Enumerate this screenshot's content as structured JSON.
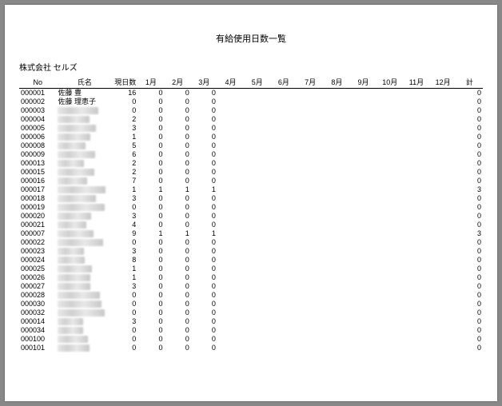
{
  "title": "有給使用日数一覧",
  "company": "株式会社 セルズ",
  "headers": {
    "no": "No",
    "name": "氏名",
    "current": "現日数",
    "months": [
      "1月",
      "2月",
      "3月",
      "4月",
      "5月",
      "6月",
      "7月",
      "8月",
      "9月",
      "10月",
      "11月",
      "12月"
    ],
    "total": "計"
  },
  "rows": [
    {
      "no": "000001",
      "name": "佐藤 豊",
      "redact": false,
      "cur": 16,
      "m": [
        0,
        0,
        0,
        "",
        "",
        "",
        "",
        "",
        "",
        "",
        "",
        ""
      ],
      "tot": 0
    },
    {
      "no": "000002",
      "name": "佐藤 理恵子",
      "redact": false,
      "cur": 0,
      "m": [
        0,
        0,
        0,
        "",
        "",
        "",
        "",
        "",
        "",
        "",
        "",
        ""
      ],
      "tot": 0
    },
    {
      "no": "000003",
      "name": "",
      "redact": true,
      "cur": 0,
      "m": [
        0,
        0,
        0,
        "",
        "",
        "",
        "",
        "",
        "",
        "",
        "",
        ""
      ],
      "tot": 0
    },
    {
      "no": "000004",
      "name": "",
      "redact": true,
      "cur": 2,
      "m": [
        0,
        0,
        0,
        "",
        "",
        "",
        "",
        "",
        "",
        "",
        "",
        ""
      ],
      "tot": 0
    },
    {
      "no": "000005",
      "name": "",
      "redact": true,
      "cur": 3,
      "m": [
        0,
        0,
        0,
        "",
        "",
        "",
        "",
        "",
        "",
        "",
        "",
        ""
      ],
      "tot": 0
    },
    {
      "no": "000006",
      "name": "",
      "redact": true,
      "cur": 1,
      "m": [
        0,
        0,
        0,
        "",
        "",
        "",
        "",
        "",
        "",
        "",
        "",
        ""
      ],
      "tot": 0
    },
    {
      "no": "000008",
      "name": "",
      "redact": true,
      "cur": 5,
      "m": [
        0,
        0,
        0,
        "",
        "",
        "",
        "",
        "",
        "",
        "",
        "",
        ""
      ],
      "tot": 0
    },
    {
      "no": "000009",
      "name": "",
      "redact": true,
      "cur": 6,
      "m": [
        0,
        0,
        0,
        "",
        "",
        "",
        "",
        "",
        "",
        "",
        "",
        ""
      ],
      "tot": 0
    },
    {
      "no": "000013",
      "name": "",
      "redact": true,
      "cur": 2,
      "m": [
        0,
        0,
        0,
        "",
        "",
        "",
        "",
        "",
        "",
        "",
        "",
        ""
      ],
      "tot": 0
    },
    {
      "no": "000015",
      "name": "",
      "redact": true,
      "cur": 2,
      "m": [
        0,
        0,
        0,
        "",
        "",
        "",
        "",
        "",
        "",
        "",
        "",
        ""
      ],
      "tot": 0
    },
    {
      "no": "000016",
      "name": "",
      "redact": true,
      "cur": 7,
      "m": [
        0,
        0,
        0,
        "",
        "",
        "",
        "",
        "",
        "",
        "",
        "",
        ""
      ],
      "tot": 0
    },
    {
      "no": "000017",
      "name": "",
      "redact": true,
      "cur": 1,
      "m": [
        1,
        1,
        1,
        "",
        "",
        "",
        "",
        "",
        "",
        "",
        "",
        ""
      ],
      "tot": 3
    },
    {
      "no": "000018",
      "name": "",
      "redact": true,
      "cur": 3,
      "m": [
        0,
        0,
        0,
        "",
        "",
        "",
        "",
        "",
        "",
        "",
        "",
        ""
      ],
      "tot": 0
    },
    {
      "no": "000019",
      "name": "",
      "redact": true,
      "cur": 0,
      "m": [
        0,
        0,
        0,
        "",
        "",
        "",
        "",
        "",
        "",
        "",
        "",
        ""
      ],
      "tot": 0
    },
    {
      "no": "000020",
      "name": "",
      "redact": true,
      "cur": 3,
      "m": [
        0,
        0,
        0,
        "",
        "",
        "",
        "",
        "",
        "",
        "",
        "",
        ""
      ],
      "tot": 0
    },
    {
      "no": "000021",
      "name": "",
      "redact": true,
      "cur": 4,
      "m": [
        0,
        0,
        0,
        "",
        "",
        "",
        "",
        "",
        "",
        "",
        "",
        ""
      ],
      "tot": 0
    },
    {
      "no": "000007",
      "name": "",
      "redact": true,
      "cur": 9,
      "m": [
        1,
        1,
        1,
        "",
        "",
        "",
        "",
        "",
        "",
        "",
        "",
        ""
      ],
      "tot": 3
    },
    {
      "no": "000022",
      "name": "",
      "redact": true,
      "cur": 0,
      "m": [
        0,
        0,
        0,
        "",
        "",
        "",
        "",
        "",
        "",
        "",
        "",
        ""
      ],
      "tot": 0
    },
    {
      "no": "000023",
      "name": "",
      "redact": true,
      "cur": 3,
      "m": [
        0,
        0,
        0,
        "",
        "",
        "",
        "",
        "",
        "",
        "",
        "",
        ""
      ],
      "tot": 0
    },
    {
      "no": "000024",
      "name": "",
      "redact": true,
      "cur": 8,
      "m": [
        0,
        0,
        0,
        "",
        "",
        "",
        "",
        "",
        "",
        "",
        "",
        ""
      ],
      "tot": 0
    },
    {
      "no": "000025",
      "name": "",
      "redact": true,
      "cur": 1,
      "m": [
        0,
        0,
        0,
        "",
        "",
        "",
        "",
        "",
        "",
        "",
        "",
        ""
      ],
      "tot": 0
    },
    {
      "no": "000026",
      "name": "",
      "redact": true,
      "cur": 1,
      "m": [
        0,
        0,
        0,
        "",
        "",
        "",
        "",
        "",
        "",
        "",
        "",
        ""
      ],
      "tot": 0
    },
    {
      "no": "000027",
      "name": "",
      "redact": true,
      "cur": 3,
      "m": [
        0,
        0,
        0,
        "",
        "",
        "",
        "",
        "",
        "",
        "",
        "",
        ""
      ],
      "tot": 0
    },
    {
      "no": "000028",
      "name": "",
      "redact": true,
      "cur": 0,
      "m": [
        0,
        0,
        0,
        "",
        "",
        "",
        "",
        "",
        "",
        "",
        "",
        ""
      ],
      "tot": 0
    },
    {
      "no": "000030",
      "name": "",
      "redact": true,
      "cur": 0,
      "m": [
        0,
        0,
        0,
        "",
        "",
        "",
        "",
        "",
        "",
        "",
        "",
        ""
      ],
      "tot": 0
    },
    {
      "no": "000032",
      "name": "",
      "redact": true,
      "cur": 0,
      "m": [
        0,
        0,
        0,
        "",
        "",
        "",
        "",
        "",
        "",
        "",
        "",
        ""
      ],
      "tot": 0
    },
    {
      "no": "000014",
      "name": "",
      "redact": true,
      "cur": 3,
      "m": [
        0,
        0,
        0,
        "",
        "",
        "",
        "",
        "",
        "",
        "",
        "",
        ""
      ],
      "tot": 0
    },
    {
      "no": "000034",
      "name": "",
      "redact": true,
      "cur": 0,
      "m": [
        0,
        0,
        0,
        "",
        "",
        "",
        "",
        "",
        "",
        "",
        "",
        ""
      ],
      "tot": 0
    },
    {
      "no": "000100",
      "name": "",
      "redact": true,
      "cur": 0,
      "m": [
        0,
        0,
        0,
        "",
        "",
        "",
        "",
        "",
        "",
        "",
        "",
        ""
      ],
      "tot": 0
    },
    {
      "no": "000101",
      "name": "",
      "redact": true,
      "cur": 0,
      "m": [
        0,
        0,
        0,
        "",
        "",
        "",
        "",
        "",
        "",
        "",
        "",
        ""
      ],
      "tot": 0
    }
  ]
}
